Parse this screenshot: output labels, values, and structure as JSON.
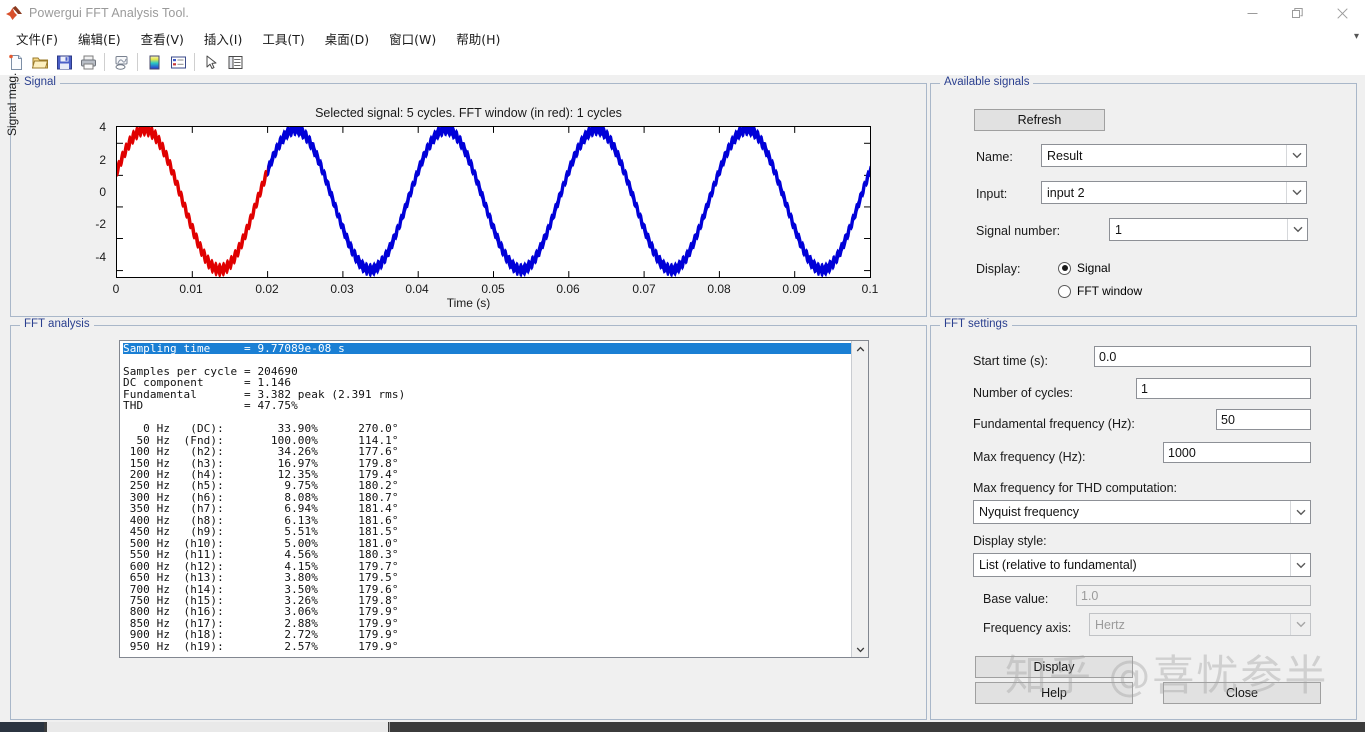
{
  "window": {
    "title": "Powergui FFT Analysis Tool.",
    "app_icon": "matlab-icon",
    "minimize": "—",
    "restore": "❐",
    "close": "✕"
  },
  "menubar": {
    "items": [
      {
        "label": "文件(F)",
        "name": "menu-file"
      },
      {
        "label": "编辑(E)",
        "name": "menu-edit"
      },
      {
        "label": "查看(V)",
        "name": "menu-view"
      },
      {
        "label": "插入(I)",
        "name": "menu-insert"
      },
      {
        "label": "工具(T)",
        "name": "menu-tools"
      },
      {
        "label": "桌面(D)",
        "name": "menu-desktop"
      },
      {
        "label": "窗口(W)",
        "name": "menu-window"
      },
      {
        "label": "帮助(H)",
        "name": "menu-help"
      }
    ],
    "overflow": "▾"
  },
  "toolbar": {
    "buttons": [
      {
        "name": "new-figure-icon"
      },
      {
        "name": "open-folder-icon"
      },
      {
        "name": "save-icon"
      },
      {
        "name": "print-icon"
      },
      {
        "name": "link-plot-icon"
      },
      {
        "name": "colorbar-icon"
      },
      {
        "name": "legend-icon"
      },
      {
        "name": "pointer-icon"
      },
      {
        "name": "property-editor-icon"
      }
    ]
  },
  "signal_panel": {
    "title": "Signal"
  },
  "fft_panel": {
    "title": "FFT analysis",
    "output_header": [
      "Sampling time     = 9.77089e-08 s",
      "Samples per cycle = 204690",
      "DC component      = 1.146",
      "Fundamental       = 3.382 peak (2.391 rms)",
      "THD               = 47.75%"
    ],
    "output_rows": [
      "   0 Hz   (DC):        33.90%      270.0°",
      "  50 Hz  (Fnd):       100.00%      114.1°",
      " 100 Hz   (h2):        34.26%      177.6°",
      " 150 Hz   (h3):        16.97%      179.8°",
      " 200 Hz   (h4):        12.35%      179.4°",
      " 250 Hz   (h5):         9.75%      180.2°",
      " 300 Hz   (h6):         8.08%      180.7°",
      " 350 Hz   (h7):         6.94%      181.4°",
      " 400 Hz   (h8):         6.13%      181.6°",
      " 450 Hz   (h9):         5.51%      181.5°",
      " 500 Hz  (h10):         5.00%      181.0°",
      " 550 Hz  (h11):         4.56%      180.3°",
      " 600 Hz  (h12):         4.15%      179.7°",
      " 650 Hz  (h13):         3.80%      179.5°",
      " 700 Hz  (h14):         3.50%      179.6°",
      " 750 Hz  (h15):         3.26%      179.8°",
      " 800 Hz  (h16):         3.06%      179.9°",
      " 850 Hz  (h17):         2.88%      179.9°",
      " 900 Hz  (h18):         2.72%      179.9°",
      " 950 Hz  (h19):         2.57%      179.9°"
    ],
    "scroll_up": "∧",
    "scroll_down": "∨"
  },
  "available_signals": {
    "title": "Available signals",
    "refresh_label": "Refresh",
    "name_label": "Name:",
    "name_value": "Result",
    "input_label": "Input:",
    "input_value": "input 2",
    "signal_number_label": "Signal number:",
    "signal_number_value": "1",
    "display_label": "Display:",
    "display_options": [
      {
        "label": "Signal",
        "selected": true
      },
      {
        "label": "FFT window",
        "selected": false
      }
    ]
  },
  "fft_settings": {
    "title": "FFT settings",
    "start_time_label": "Start time (s):",
    "start_time_value": "0.0",
    "cycles_label": "Number of cycles:",
    "cycles_value": "1",
    "fundamental_label": "Fundamental frequency (Hz):",
    "fundamental_value": "50",
    "maxfreq_label": "Max frequency (Hz):",
    "maxfreq_value": "1000",
    "thd_label": "Max frequency for THD computation:",
    "thd_value": "Nyquist frequency",
    "style_label": "Display style:",
    "style_value": "List (relative to fundamental)",
    "base_label": "Base value:",
    "base_value": "1.0",
    "freqaxis_label": "Frequency axis:",
    "freqaxis_value": "Hertz"
  },
  "actions": {
    "display_label": "Display",
    "help_label": "Help",
    "close_label": "Close"
  },
  "watermark": {
    "text": "知乎 @喜忧参半"
  },
  "chart_data": {
    "type": "line",
    "title": "Selected signal: 5 cycles. FFT window (in red): 1 cycles",
    "xlabel": "Time (s)",
    "ylabel": "Signal mag.",
    "xlim": [
      0,
      0.1
    ],
    "ylim": [
      -4.8,
      4.8
    ],
    "xticks": [
      "0",
      "0.01",
      "0.02",
      "0.03",
      "0.04",
      "0.05",
      "0.06",
      "0.07",
      "0.08",
      "0.09",
      "0.1"
    ],
    "yticks": [
      "4",
      "2",
      "0",
      "-2",
      "-4"
    ],
    "grid": false,
    "series": [
      {
        "name": "FFT window",
        "color": "#e00000",
        "x_range": [
          0,
          0.02
        ],
        "description": "Highlighted first cycle of the selected waveform, drawn in red"
      },
      {
        "name": "Selected signal",
        "color": "#0000d8",
        "x_range": [
          0.02,
          0.1
        ],
        "description": "Remaining four cycles of the selected waveform, drawn in blue"
      }
    ],
    "waveform": {
      "fundamental_hz": 50,
      "cycles_shown": 5,
      "amplitude": 4.5,
      "dc_offset": 0.15,
      "phase_deg": 114.1,
      "ripple_amplitude": 0.35,
      "ripple_hz": 2000,
      "note": "Thick band appearance is high-frequency switching ripple superimposed on the 50 Hz fundamental"
    }
  }
}
